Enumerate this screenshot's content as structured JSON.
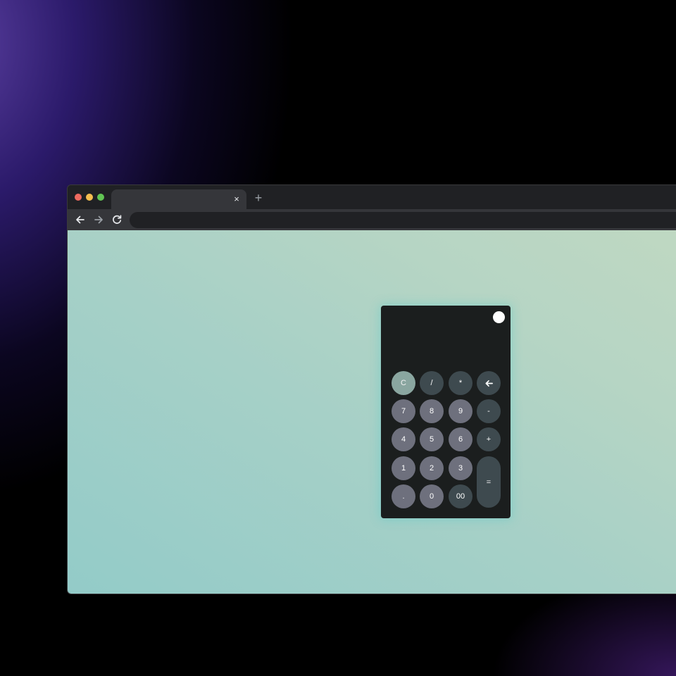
{
  "browser": {
    "tab_title": "",
    "tab_close_glyph": "×",
    "new_tab_glyph": "+",
    "address_value": "",
    "nav_icons": [
      "back-arrow-icon",
      "forward-arrow-icon",
      "reload-icon"
    ],
    "traffic_light_colors": [
      "#ee6a5f",
      "#f5be4f",
      "#62c554"
    ]
  },
  "calculator": {
    "display_value": "",
    "theme_toggle_color": "#ffffff",
    "keys": {
      "clear": "C",
      "divide": "/",
      "multiply": "*",
      "backspace_icon": "left-arrow-icon",
      "seven": "7",
      "eight": "8",
      "nine": "9",
      "minus": "-",
      "four": "4",
      "five": "5",
      "six": "6",
      "plus": "+",
      "one": "1",
      "two": "2",
      "three": "3",
      "equals": "=",
      "decimal": ".",
      "zero": "0",
      "double_zero": "00"
    },
    "colors": {
      "number_key": "#6e707d",
      "operator_key": "#3e4a4f",
      "clear_key": "#8aa6a0",
      "body": "#1b1e1e"
    }
  }
}
